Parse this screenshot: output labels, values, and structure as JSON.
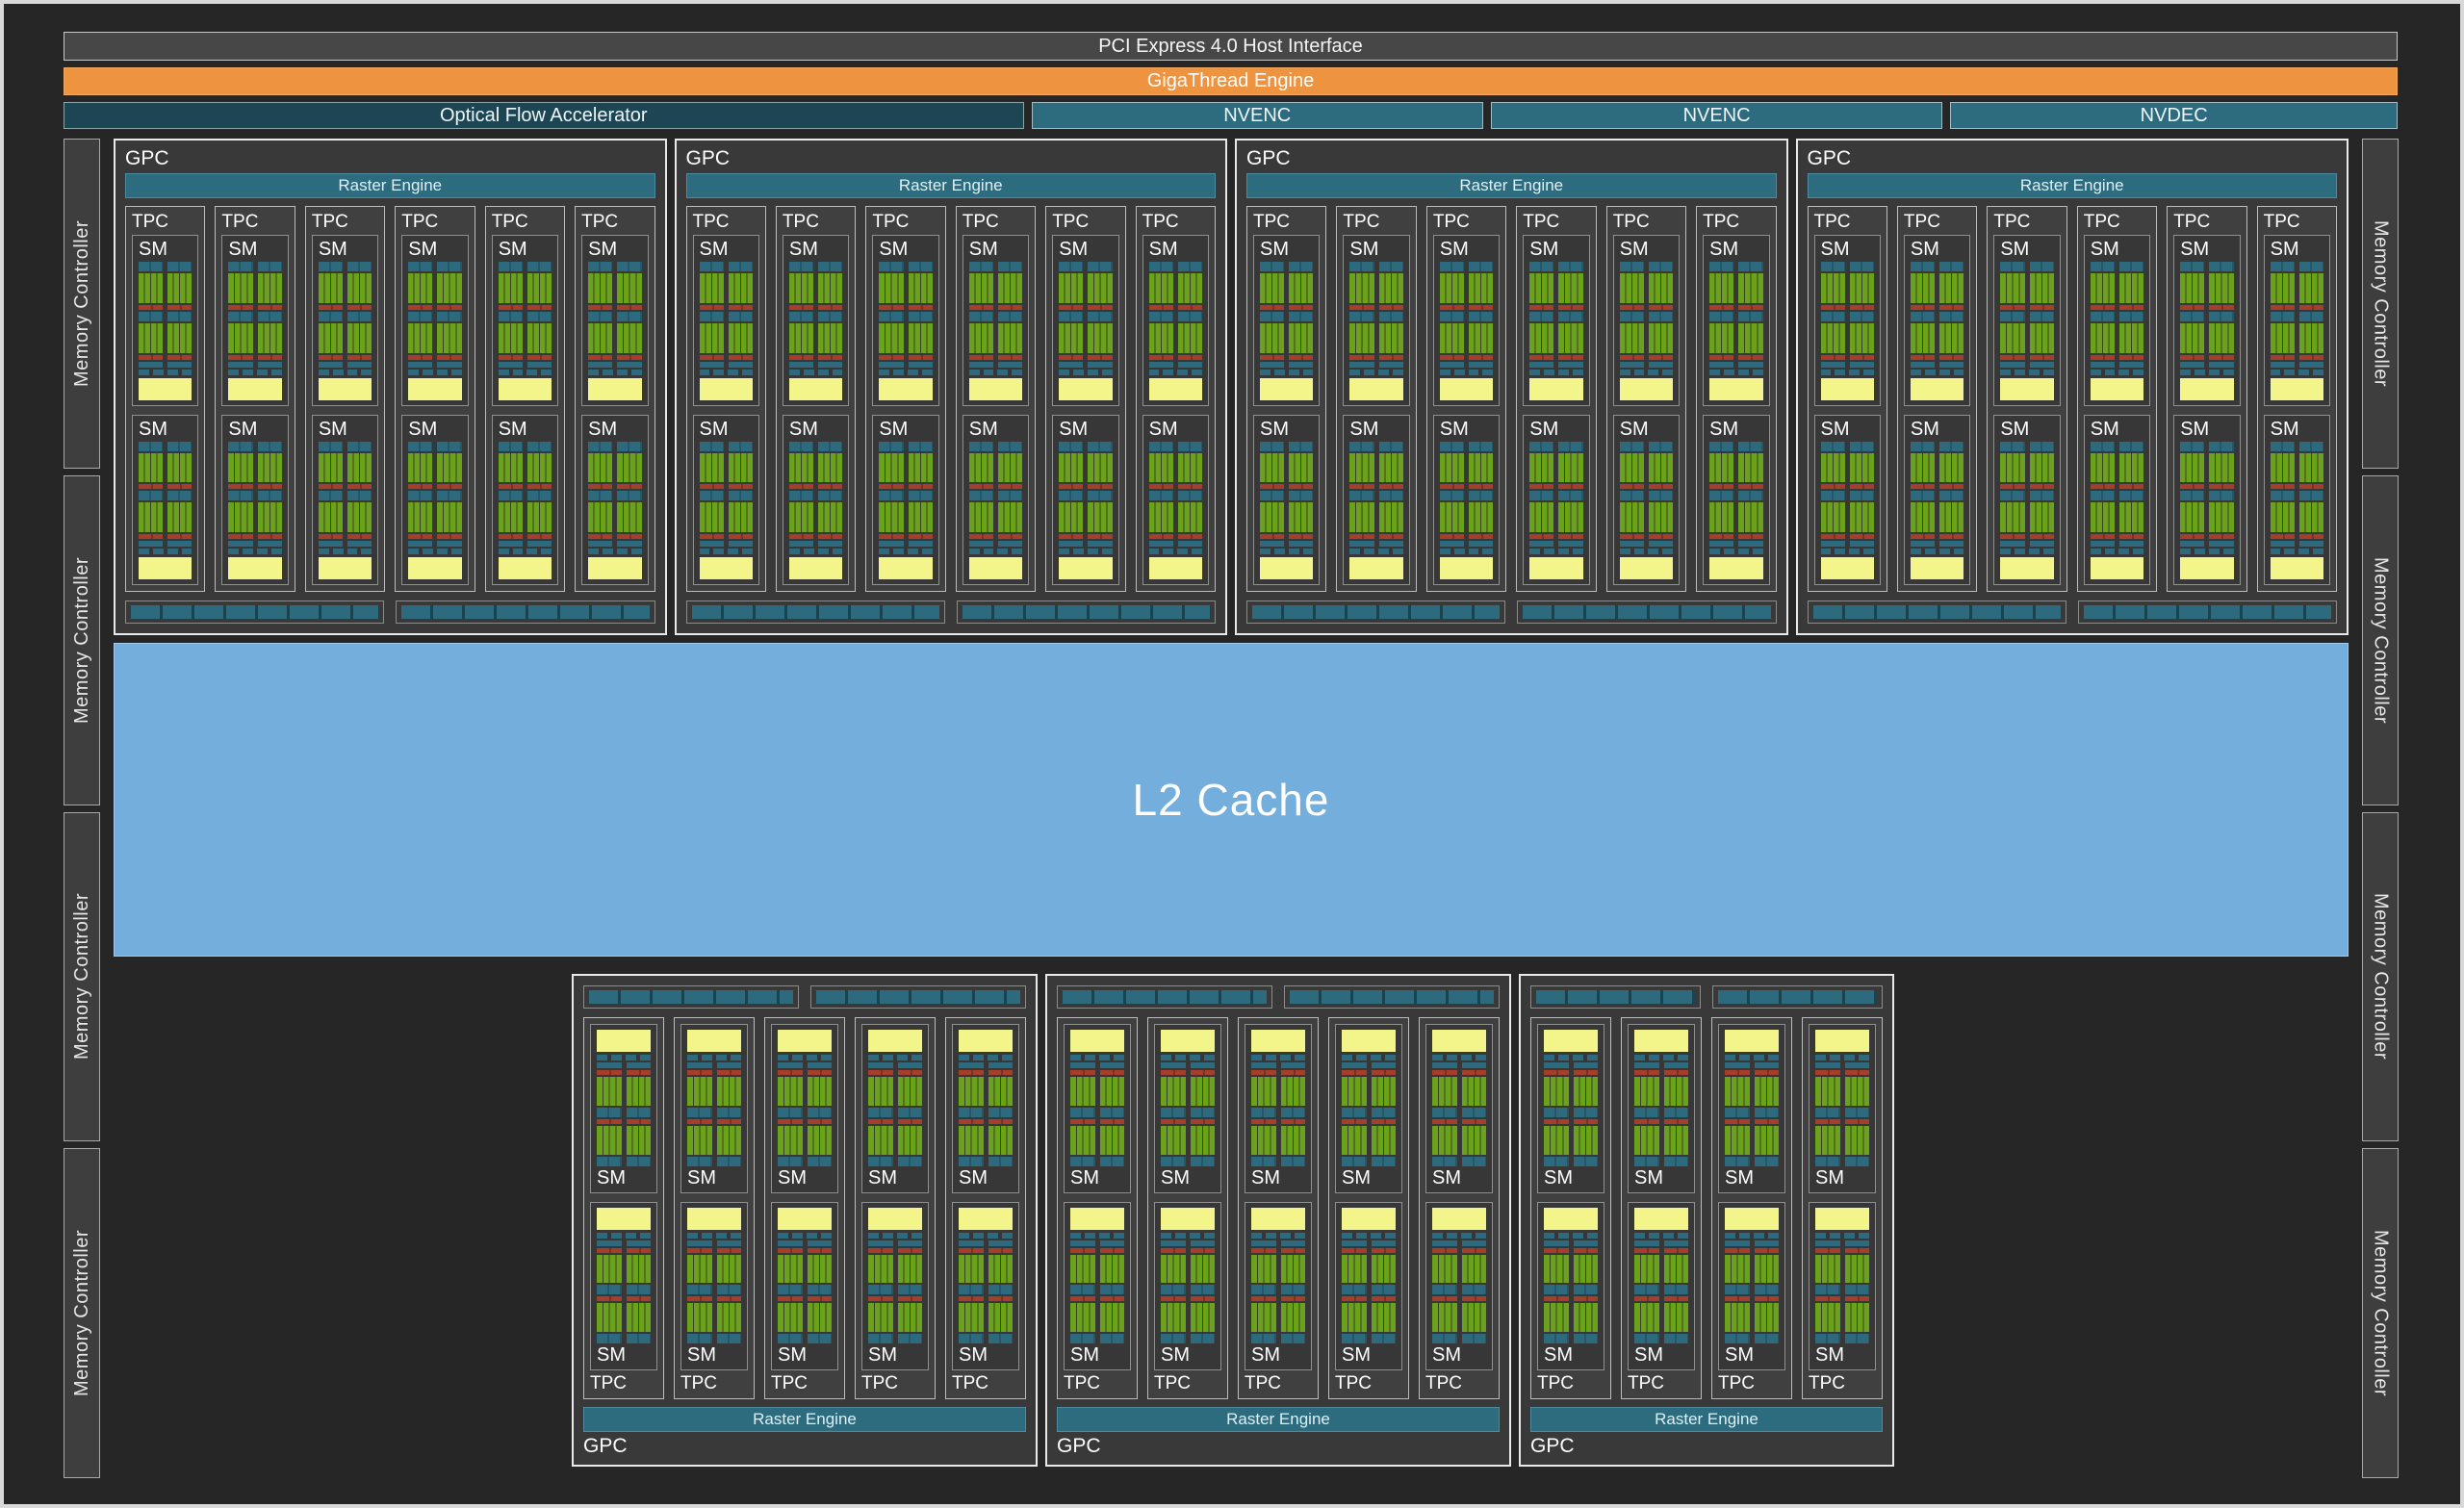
{
  "header": {
    "pci_label": "PCI Express 4.0 Host Interface",
    "gigathread_label": "GigaThread Engine",
    "media_engines": [
      {
        "label": "Optical Flow Accelerator",
        "variant": "dark"
      },
      {
        "label": "NVENC",
        "variant": "light"
      },
      {
        "label": "NVENC",
        "variant": "light"
      },
      {
        "label": "NVDEC",
        "variant": "light"
      }
    ]
  },
  "labels": {
    "gpc": "GPC",
    "raster_engine": "Raster Engine",
    "tpc": "TPC",
    "sm": "SM",
    "memory_controller": "Memory Controller",
    "l2_cache": "L2 Cache"
  },
  "layout": {
    "top_gpc_tpc_counts": [
      6,
      6,
      6,
      6
    ],
    "bottom_gpc_tpc_counts": [
      5,
      5,
      4
    ],
    "sms_per_tpc": 2,
    "rop_partitions_per_gpc": 2,
    "memory_controllers_per_side": 4
  },
  "colors": {
    "background": "#262626",
    "frame": "#d9d9d9",
    "pci_bar": "#474747",
    "gigathread_orange": "#ee9340",
    "media_dark_teal": "#1d4654",
    "media_teal": "#2d6b7e",
    "raster_teal": "#2d6b7e",
    "sm_green": "#6ba21c",
    "sm_red": "#a63e2c",
    "sm_yellow": "#f3f489",
    "l2_blue": "#73aedd"
  }
}
